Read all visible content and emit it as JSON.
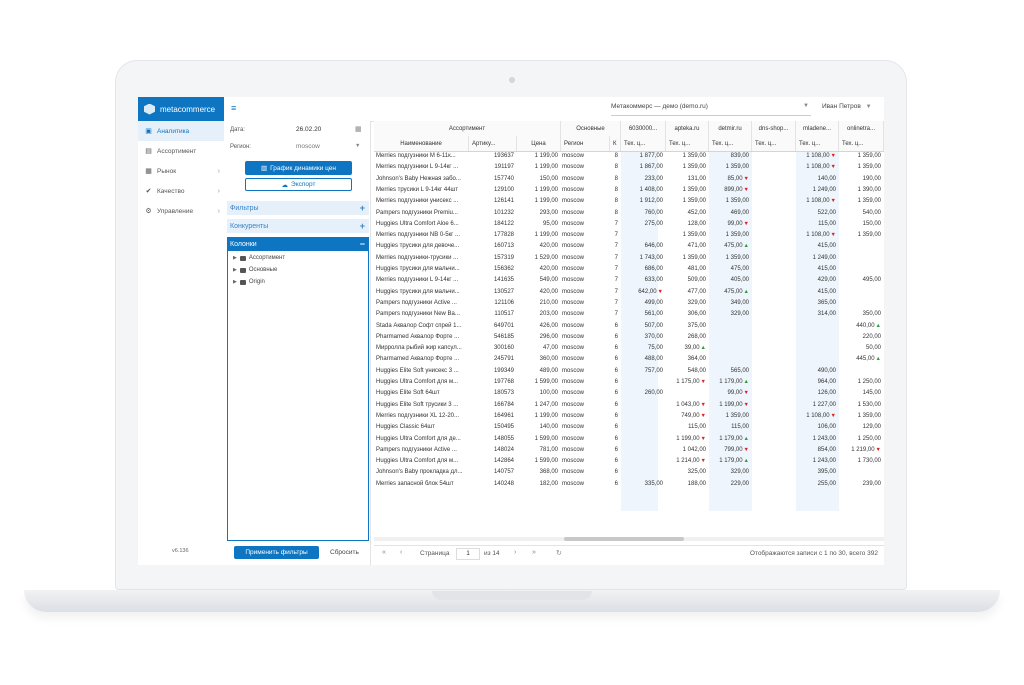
{
  "app": {
    "brand": "metacommerce",
    "version": "v6.136"
  },
  "nav": [
    {
      "label": "Аналитика",
      "icon": "analytics-icon",
      "glyph": "▣",
      "active": true,
      "arrow": ""
    },
    {
      "label": "Ассортимент",
      "icon": "assortment-icon",
      "glyph": "▤",
      "active": false,
      "arrow": ""
    },
    {
      "label": "Рынок",
      "icon": "market-icon",
      "glyph": "▦",
      "active": false,
      "arrow": "›"
    },
    {
      "label": "Качество",
      "icon": "quality-icon",
      "glyph": "✔",
      "active": false,
      "arrow": "›"
    },
    {
      "label": "Управление",
      "icon": "settings-icon",
      "glyph": "⚙",
      "active": false,
      "arrow": "›"
    }
  ],
  "topbar": {
    "org": "Метакоммерс — демо (demo.ru)",
    "user": "Иван Петров"
  },
  "filters": {
    "date_label": "Дата:",
    "date_value": "26.02.20",
    "region_label": "Регион:",
    "region_value": "moscow",
    "chart_button": "График динамики цен",
    "export_button": "Экспорт",
    "panel_filters": "Фильтры",
    "panel_competitors": "Конкуренты",
    "panel_columns": "Колонки",
    "tree": [
      "Ассортимент",
      "Основные",
      "Origin"
    ],
    "apply_button": "Применить фильтры",
    "reset_button": "Сбросить"
  },
  "grid": {
    "groups": [
      "Ассортимент",
      "Основные",
      "6030000...",
      "apteka.ru",
      "detmir.ru",
      "dns-shop...",
      "mladene...",
      "onlinetra..."
    ],
    "columns": [
      "Наименование",
      "Артику...",
      "Цена",
      "Регион",
      "К",
      "Тех. ц...",
      "Тех. ц...",
      "Тех. ц...",
      "Тех. ц...",
      "Тех. ц...",
      "Тех. ц..."
    ],
    "rows": [
      [
        "Merries подгузники M 6-11к...",
        "193637",
        "1 199,00",
        "moscow",
        "8",
        "1 877,00",
        "1 359,00",
        "839,00",
        "",
        "1 108,00 ▼",
        "1 359,00"
      ],
      [
        "Merries подгузники L 9-14кг ...",
        "191197",
        "1 199,00",
        "moscow",
        "8",
        "1 867,00",
        "1 359,00",
        "1 359,00",
        "",
        "1 108,00 ▼",
        "1 359,00"
      ],
      [
        "Johnson's Baby Нежная забо...",
        "157740",
        "150,00",
        "moscow",
        "8",
        "233,00",
        "131,00",
        "85,00 ▼",
        "",
        "140,00",
        "190,00"
      ],
      [
        "Merries трусики L 9-14кг 44шт",
        "129100",
        "1 199,00",
        "moscow",
        "8",
        "1 408,00",
        "1 359,00",
        "899,00 ▼",
        "",
        "1 249,00",
        "1 390,00"
      ],
      [
        "Merries подгузники унисекс ...",
        "126141",
        "1 199,00",
        "moscow",
        "8",
        "1 912,00",
        "1 359,00",
        "1 359,00",
        "",
        "1 108,00 ▼",
        "1 359,00"
      ],
      [
        "Pampers подгузники Premiu...",
        "101232",
        "293,00",
        "moscow",
        "8",
        "760,00",
        "452,00",
        "469,00",
        "",
        "522,00",
        "540,00"
      ],
      [
        "Huggies Ultra Comfort Aloe 6...",
        "184122",
        "95,00",
        "moscow",
        "7",
        "275,00",
        "128,00",
        "99,00 ▼",
        "",
        "115,00",
        "150,00"
      ],
      [
        "Merries подгузники NB 0-5кг ...",
        "177828",
        "1 199,00",
        "moscow",
        "7",
        "",
        "1 359,00",
        "1 359,00",
        "",
        "1 108,00 ▼",
        "1 359,00"
      ],
      [
        "Huggies трусики для девоче...",
        "160713",
        "420,00",
        "moscow",
        "7",
        "646,00",
        "471,00",
        "475,00 ▲",
        "",
        "415,00",
        ""
      ],
      [
        "Merries подгузники-трусики ...",
        "157319",
        "1 529,00",
        "moscow",
        "7",
        "1 743,00",
        "1 359,00",
        "1 359,00",
        "",
        "1 249,00",
        ""
      ],
      [
        "Huggies трусики для мальчи...",
        "156362",
        "420,00",
        "moscow",
        "7",
        "686,00",
        "481,00",
        "475,00",
        "",
        "415,00",
        ""
      ],
      [
        "Merries подгузники L 9-14кг ...",
        "141635",
        "549,00",
        "moscow",
        "7",
        "633,00",
        "509,00",
        "405,00",
        "",
        "429,00",
        "495,00"
      ],
      [
        "Huggies трусики для мальчи...",
        "130527",
        "420,00",
        "moscow",
        "7",
        "642,00 ▼",
        "477,00",
        "475,00 ▲",
        "",
        "415,00",
        ""
      ],
      [
        "Pampers подгузники Active ...",
        "121106",
        "210,00",
        "moscow",
        "7",
        "499,00",
        "329,00",
        "349,00",
        "",
        "365,00",
        ""
      ],
      [
        "Pampers подгузники New Ba...",
        "110517",
        "203,00",
        "moscow",
        "7",
        "561,00",
        "306,00",
        "329,00",
        "",
        "314,00",
        "350,00"
      ],
      [
        "Stada Аквалор Софт спрей 1...",
        "649701",
        "426,00",
        "moscow",
        "6",
        "507,00",
        "375,00",
        "",
        "",
        "",
        "440,00 ▲"
      ],
      [
        "Pharmamed Аквалор Форте ...",
        "546185",
        "296,00",
        "moscow",
        "6",
        "370,00",
        "268,00",
        "",
        "",
        "",
        "220,00"
      ],
      [
        "Мирролла рыбий жир капсул...",
        "300160",
        "47,00",
        "moscow",
        "6",
        "75,00",
        "39,00 ▲",
        "",
        "",
        "",
        "50,00"
      ],
      [
        "Pharmamed Аквалор Форте ...",
        "245791",
        "360,00",
        "moscow",
        "6",
        "488,00",
        "364,00",
        "",
        "",
        "",
        "445,00 ▲"
      ],
      [
        "Huggies Elite Soft унисекс 3 ...",
        "199349",
        "489,00",
        "moscow",
        "6",
        "757,00",
        "548,00",
        "565,00",
        "",
        "490,00",
        ""
      ],
      [
        "Huggies Ultra Comfort для м...",
        "197768",
        "1 599,00",
        "moscow",
        "6",
        "",
        "1 175,00 ▼",
        "1 179,00 ▲",
        "",
        "964,00",
        "1 250,00"
      ],
      [
        "Huggies Elite Soft 64шт",
        "180573",
        "100,00",
        "moscow",
        "6",
        "260,00",
        "",
        "99,00 ▼",
        "",
        "126,00",
        "145,00"
      ],
      [
        "Huggies Elite Soft трусики 3 ...",
        "166784",
        "1 247,00",
        "moscow",
        "6",
        "",
        "1 043,00 ▼",
        "1 199,00 ▼",
        "",
        "1 227,00",
        "1 530,00"
      ],
      [
        "Merries подгузники XL 12-20...",
        "164961",
        "1 199,00",
        "moscow",
        "6",
        "",
        "749,00 ▼",
        "1 359,00",
        "",
        "1 108,00 ▼",
        "1 359,00"
      ],
      [
        "Huggies Classic 64шт",
        "150495",
        "140,00",
        "moscow",
        "6",
        "",
        "115,00",
        "115,00",
        "",
        "106,00",
        "129,00"
      ],
      [
        "Huggies Ultra Comfort для де...",
        "148055",
        "1 599,00",
        "moscow",
        "6",
        "",
        "1 199,00 ▼",
        "1 179,00 ▲",
        "",
        "1 243,00",
        "1 250,00"
      ],
      [
        "Pampers подгузники Active ...",
        "148024",
        "781,00",
        "moscow",
        "6",
        "",
        "1 042,00",
        "799,00 ▼",
        "",
        "854,00",
        "1 219,00 ▼"
      ],
      [
        "Huggies Ultra Comfort для м...",
        "142864",
        "1 599,00",
        "moscow",
        "6",
        "",
        "1 214,00 ▼",
        "1 179,00 ▲",
        "",
        "1 243,00",
        "1 730,00"
      ],
      [
        "Johnson's Baby прокладка дл...",
        "140757",
        "368,00",
        "moscow",
        "6",
        "",
        "325,00",
        "329,00",
        "",
        "395,00",
        ""
      ],
      [
        "Merries запасной блок 54шт",
        "140248",
        "182,00",
        "moscow",
        "6",
        "335,00",
        "188,00",
        "229,00",
        "",
        "255,00",
        "239,00"
      ]
    ]
  },
  "pager": {
    "page_label": "Страница",
    "page": "1",
    "of": "из 14",
    "summary": "Отображаются записи с 1 по 30, всего 392"
  }
}
